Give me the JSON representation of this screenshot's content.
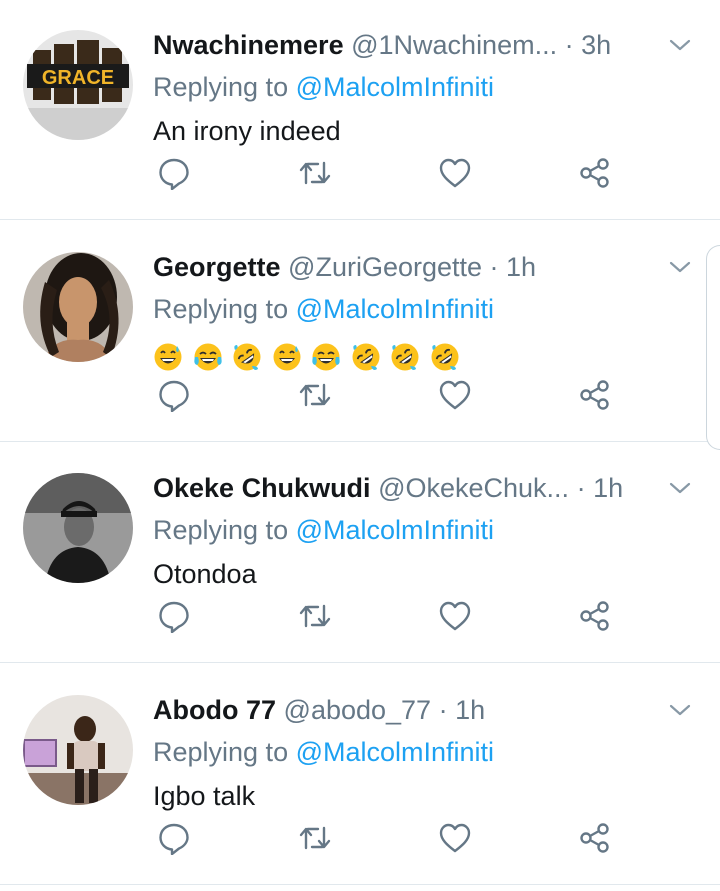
{
  "tweets": [
    {
      "name": "Nwachinemere",
      "handle": "@1Nwachinem...",
      "time": "· 3h",
      "replying_prefix": "Replying to ",
      "replying_to": "@MalcolmInfiniti",
      "body": "An irony indeed",
      "avatar_text": "GRACE"
    },
    {
      "name": "Georgette",
      "handle": "@ZuriGeorgette",
      "time": "· 1h",
      "replying_prefix": "Replying to ",
      "replying_to": "@MalcolmInfiniti",
      "body": "",
      "body_emoji": [
        "grinning-sweat",
        "tears-of-joy",
        "rofl",
        "grinning-sweat",
        "tears-of-joy",
        "rofl",
        "rofl",
        "rofl"
      ]
    },
    {
      "name": "Okeke Chukwudi",
      "handle": "@OkekeChuk...",
      "time": "· 1h",
      "replying_prefix": "Replying to ",
      "replying_to": "@MalcolmInfiniti",
      "body": "Otondoa"
    },
    {
      "name": "Abodo 77",
      "handle": "@abodo_77",
      "time": "· 1h",
      "replying_prefix": "Replying to ",
      "replying_to": "@MalcolmInfiniti",
      "body": "Igbo talk"
    }
  ],
  "icons": {
    "reply": "reply-icon",
    "retweet": "retweet-icon",
    "like": "like-icon",
    "share": "share-icon",
    "more": "chevron-down-icon"
  },
  "colors": {
    "text": "#14171a",
    "secondary": "#657786",
    "accent": "#1da1f2",
    "divider": "#e1e8ed"
  }
}
